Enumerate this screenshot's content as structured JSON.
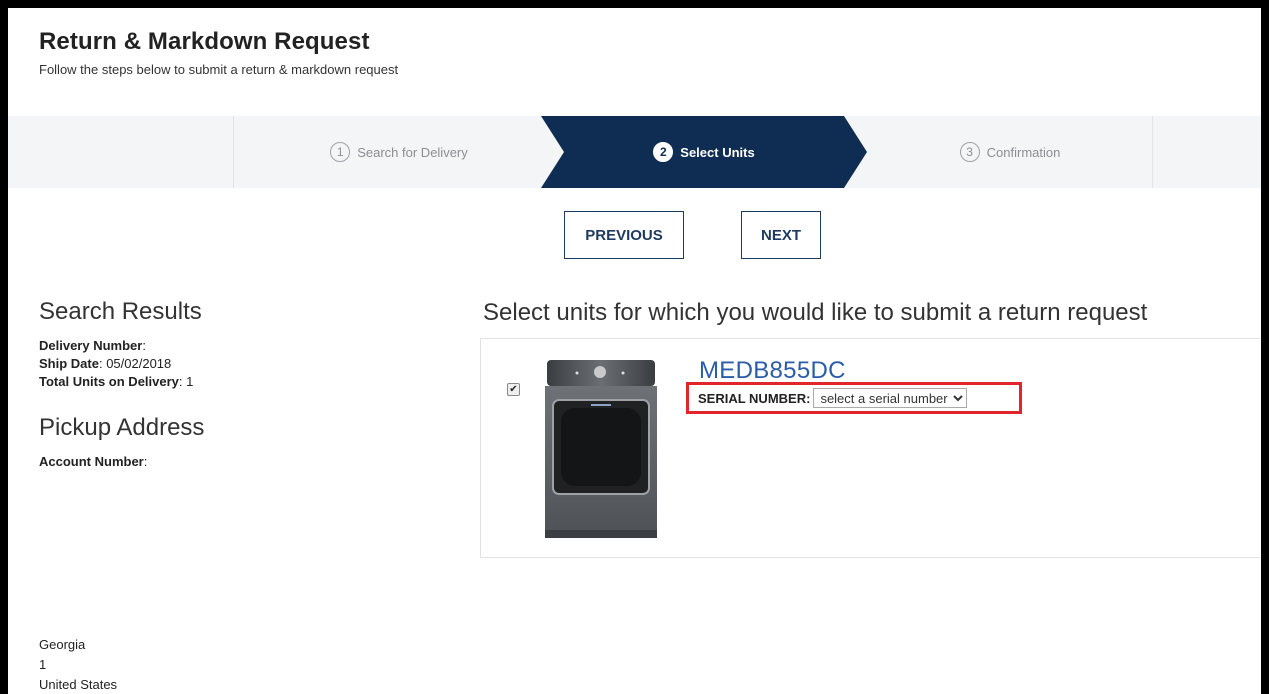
{
  "header": {
    "title": "Return & Markdown Request",
    "subtitle": "Follow the steps below to submit a return & markdown request"
  },
  "steps": [
    {
      "number": "1",
      "label": "Search for Delivery",
      "state": "complete"
    },
    {
      "number": "2",
      "label": "Select Units",
      "state": "active"
    },
    {
      "number": "3",
      "label": "Confirmation",
      "state": "pending"
    }
  ],
  "buttons": {
    "previous": "PREVIOUS",
    "next": "NEXT"
  },
  "search_results": {
    "heading": "Search Results",
    "delivery_number_label": "Delivery Number",
    "delivery_number_value": "",
    "ship_date_label": "Ship Date",
    "ship_date_value": "05/02/2018",
    "total_units_label": "Total Units on Delivery",
    "total_units_value": "1"
  },
  "pickup": {
    "heading": "Pickup Address",
    "account_number_label": "Account Number",
    "account_number_value": ""
  },
  "units": {
    "title": "Select units for which you would like to submit a return request",
    "items": [
      {
        "checked": true,
        "model": "MEDB855DC",
        "serial_label": "SERIAL NUMBER:",
        "serial_placeholder": "select a serial number"
      }
    ]
  },
  "address": {
    "state": "Georgia",
    "line2": "1",
    "country": "United States"
  },
  "colors": {
    "brand_navy": "#0f2d52",
    "link_blue": "#2a5caa",
    "highlight_red": "#e0262b"
  }
}
